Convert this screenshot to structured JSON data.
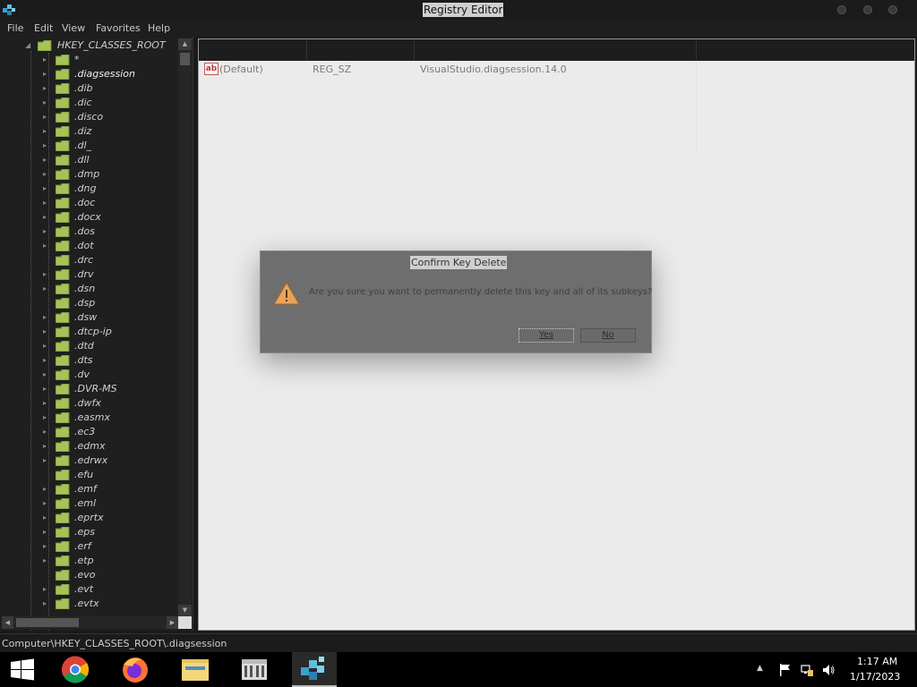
{
  "window": {
    "title": "Registry Editor"
  },
  "menu": [
    "File",
    "Edit",
    "View",
    "Favorites",
    "Help"
  ],
  "tree": {
    "root": "HKEY_CLASSES_ROOT",
    "items": [
      {
        "label": "*",
        "expandable": true
      },
      {
        "label": ".diagsession",
        "expandable": true,
        "selected": true
      },
      {
        "label": ".dib",
        "expandable": true
      },
      {
        "label": ".dic",
        "expandable": true
      },
      {
        "label": ".disco",
        "expandable": true
      },
      {
        "label": ".diz",
        "expandable": true
      },
      {
        "label": ".dl_",
        "expandable": true
      },
      {
        "label": ".dll",
        "expandable": true
      },
      {
        "label": ".dmp",
        "expandable": true
      },
      {
        "label": ".dng",
        "expandable": true
      },
      {
        "label": ".doc",
        "expandable": true
      },
      {
        "label": ".docx",
        "expandable": true
      },
      {
        "label": ".dos",
        "expandable": true
      },
      {
        "label": ".dot",
        "expandable": true
      },
      {
        "label": ".drc",
        "expandable": false
      },
      {
        "label": ".drv",
        "expandable": true
      },
      {
        "label": ".dsn",
        "expandable": true
      },
      {
        "label": ".dsp",
        "expandable": false
      },
      {
        "label": ".dsw",
        "expandable": true
      },
      {
        "label": ".dtcp-ip",
        "expandable": true
      },
      {
        "label": ".dtd",
        "expandable": true
      },
      {
        "label": ".dts",
        "expandable": true
      },
      {
        "label": ".dv",
        "expandable": true
      },
      {
        "label": ".DVR-MS",
        "expandable": true
      },
      {
        "label": ".dwfx",
        "expandable": true
      },
      {
        "label": ".easmx",
        "expandable": true
      },
      {
        "label": ".ec3",
        "expandable": true
      },
      {
        "label": ".edmx",
        "expandable": true
      },
      {
        "label": ".edrwx",
        "expandable": true
      },
      {
        "label": ".efu",
        "expandable": false
      },
      {
        "label": ".emf",
        "expandable": true
      },
      {
        "label": ".eml",
        "expandable": true
      },
      {
        "label": ".eprtx",
        "expandable": true
      },
      {
        "label": ".eps",
        "expandable": true
      },
      {
        "label": ".erf",
        "expandable": true
      },
      {
        "label": ".etp",
        "expandable": true
      },
      {
        "label": ".evo",
        "expandable": false
      },
      {
        "label": ".evt",
        "expandable": true
      },
      {
        "label": ".evtx",
        "expandable": true
      }
    ]
  },
  "values": {
    "rows": [
      {
        "name": "(Default)",
        "type": "REG_SZ",
        "data": "VisualStudio.diagsession.14.0"
      }
    ]
  },
  "dialog": {
    "title": "Confirm Key Delete",
    "message": "Are you sure you want to permanently delete this key and all of its subkeys?",
    "yes": "Yes",
    "no": "No"
  },
  "status": {
    "path": "Computer\\HKEY_CLASSES_ROOT\\.diagsession"
  },
  "taskbar": {
    "apps": [
      "windows-start-icon",
      "chrome-icon",
      "firefox-icon",
      "file-explorer-icon",
      "store-icon",
      "registry-editor-icon"
    ],
    "clock": {
      "time": "1:17 AM",
      "date": "1/17/2023"
    }
  },
  "colors": {
    "dialog_bg": "#6e6e6e",
    "pane_bg": "#ebebeb",
    "folder": "#a6c35a"
  }
}
